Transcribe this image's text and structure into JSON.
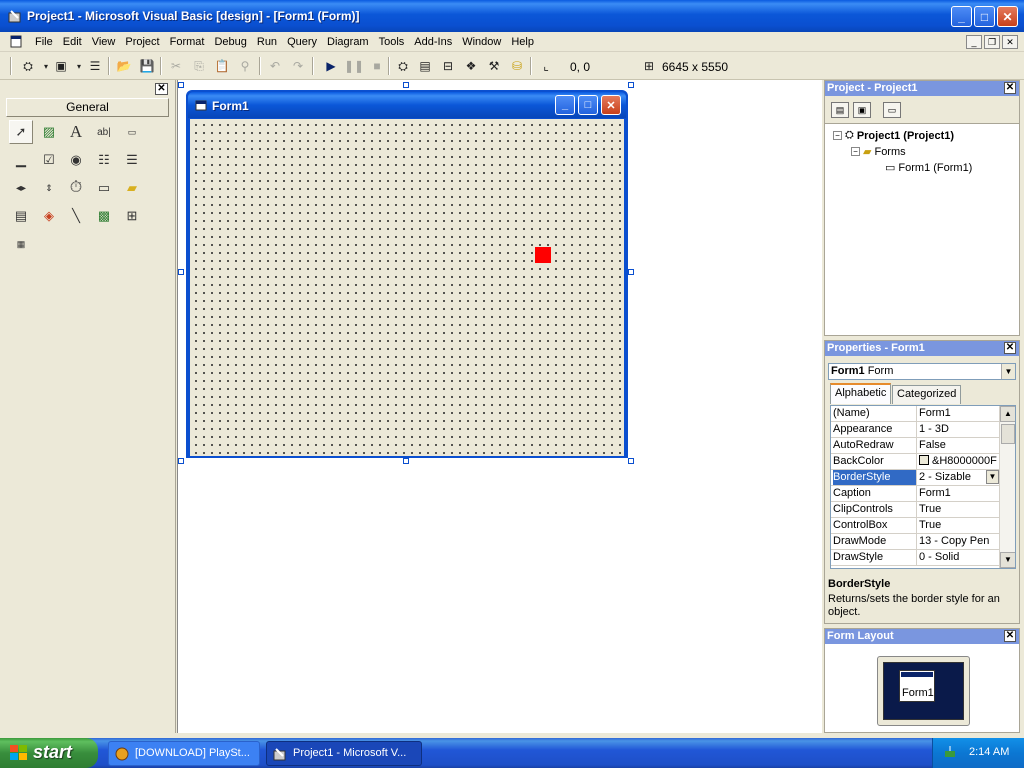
{
  "window": {
    "title": "Project1 - Microsoft Visual Basic [design] - [Form1 (Form)]",
    "minimize": "_",
    "maximize": "□",
    "close": "✕"
  },
  "menu": {
    "items": [
      {
        "label": "File"
      },
      {
        "label": "Edit"
      },
      {
        "label": "View"
      },
      {
        "label": "Project"
      },
      {
        "label": "Format"
      },
      {
        "label": "Debug"
      },
      {
        "label": "Run"
      },
      {
        "label": "Query"
      },
      {
        "label": "Diagram"
      },
      {
        "label": "Tools"
      },
      {
        "label": "Add-Ins"
      },
      {
        "label": "Window"
      },
      {
        "label": "Help"
      }
    ]
  },
  "toolbar": {
    "coords": "0, 0",
    "size": "6645 x 5550"
  },
  "toolbox": {
    "tab_label": "General",
    "close": "✕"
  },
  "form": {
    "caption": "Form1"
  },
  "project_panel": {
    "title": "Project - Project1",
    "close": "✕",
    "tree": {
      "root": "Project1 (Project1)",
      "folder": "Forms",
      "leaf": "Form1 (Form1)"
    }
  },
  "properties_panel": {
    "title": "Properties - Form1",
    "close": "✕",
    "object_name": "Form1",
    "object_type": "Form",
    "tabs": [
      "Alphabetic",
      "Categorized"
    ],
    "rows": [
      {
        "name": "(Name)",
        "value": "Form1"
      },
      {
        "name": "Appearance",
        "value": "1 - 3D"
      },
      {
        "name": "AutoRedraw",
        "value": "False"
      },
      {
        "name": "BackColor",
        "value": "&H8000000F"
      },
      {
        "name": "BorderStyle",
        "value": "2 - Sizable"
      },
      {
        "name": "Caption",
        "value": "Form1"
      },
      {
        "name": "ClipControls",
        "value": "True"
      },
      {
        "name": "ControlBox",
        "value": "True"
      },
      {
        "name": "DrawMode",
        "value": "13 - Copy Pen"
      },
      {
        "name": "DrawStyle",
        "value": "0 - Solid"
      }
    ],
    "selected_row": "BorderStyle",
    "description_title": "BorderStyle",
    "description": "Returns/sets the border style for an object."
  },
  "layout_panel": {
    "title": "Form Layout",
    "close": "✕",
    "mini_form_label": "Form1"
  },
  "taskbar": {
    "start_label": "start",
    "tasks": [
      {
        "label": "[DOWNLOAD] PlaySt..."
      },
      {
        "label": "Project1 - Microsoft V..."
      }
    ],
    "clock": "2:14 AM"
  },
  "colors": {
    "xp_blue": "#0b57d8",
    "selection": "#316ac5",
    "red_control": "#ff0000"
  }
}
